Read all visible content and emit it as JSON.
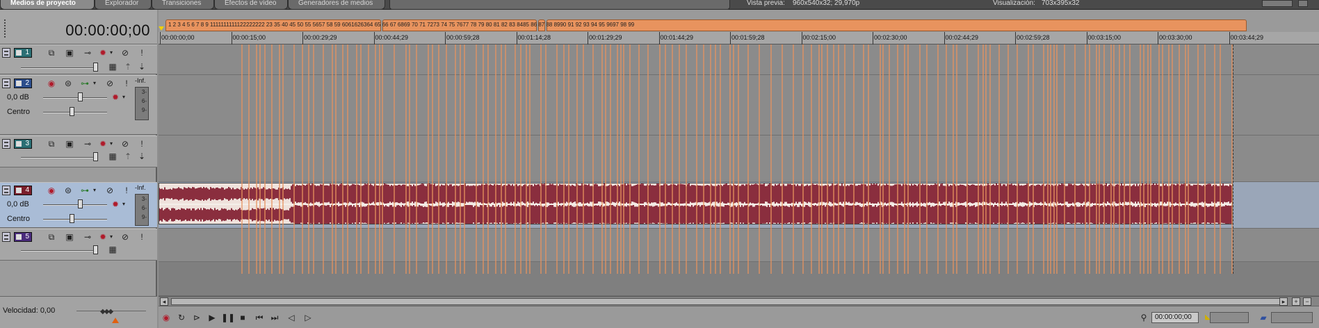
{
  "tabs": [
    {
      "label": "Medios de proyecto",
      "active": true
    },
    {
      "label": "Explorador",
      "active": false
    },
    {
      "label": "Transiciones",
      "active": false
    },
    {
      "label": "Efectos de vídeo",
      "active": false
    },
    {
      "label": "Generadores de medios",
      "active": false
    }
  ],
  "preview": {
    "label": "Vista previa:",
    "value": "960x540x32; 29,970p",
    "display_label": "Visualización:",
    "display_value": "703x395x32"
  },
  "timecode": "00:00:00;00",
  "tracks": [
    {
      "number": "1",
      "type": "video",
      "name": "track-1"
    },
    {
      "number": "2",
      "type": "audio",
      "volume": "0,0 dB",
      "pan": "Centro",
      "meter_top": "-Inf.",
      "meter_ticks": [
        "3-",
        "6-",
        "9-"
      ]
    },
    {
      "number": "3",
      "type": "video",
      "name": "track-3"
    },
    {
      "number": "4",
      "type": "audio",
      "volume": "0,0 dB",
      "pan": "Centro",
      "meter_top": "-Inf.",
      "meter_ticks": [
        "3-",
        "6-",
        "9-"
      ]
    },
    {
      "number": "5",
      "type": "video",
      "name": "track-5"
    }
  ],
  "velocity": "Velocidad: 0,00",
  "markers_text": "1 2 3 4 5 6 7 8 9 1111111111122222222 23   35   40  45  50    55 5657 58 59 6061626364 65 66 67 6869 70 71 7273 74 75 7677 78  79 80 81 82 83 8485 86 87 88 8990 91 92 93 94 95 9697 98 99",
  "ruler_labels": [
    "00:00:00;00",
    "00:00:15;00",
    "00:00:29;29",
    "00:00:44;29",
    "00:00:59;28",
    "00:01:14;28",
    "00:01:29;29",
    "00:01:44;29",
    "00:01:59;28",
    "00:02:15;00",
    "00:02:30;00",
    "00:02:44;29",
    "00:02:59;28",
    "00:03:15;00",
    "00:03:30;00",
    "00:03:44;29"
  ],
  "transport_timecode": "00:00:00;00",
  "colors": {
    "marker": "#e8935e",
    "audio_wave": "#8a2e3e",
    "audio_bg": "#efe2dc",
    "selected_track": "#a9bcd6"
  }
}
